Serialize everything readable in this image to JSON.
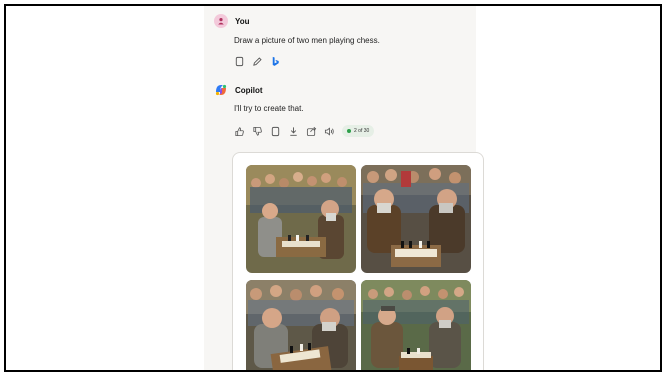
{
  "conversation": {
    "user": {
      "name": "You",
      "message": "Draw a picture of two men playing chess.",
      "actions": [
        "copy-icon",
        "edit-icon",
        "bing-icon"
      ]
    },
    "assistant": {
      "name": "Copilot",
      "message": "I'll try to create that.",
      "actions": [
        "thumbs-up-icon",
        "thumbs-down-icon",
        "copy-icon",
        "download-icon",
        "share-icon",
        "speaker-icon"
      ],
      "response_counter": "2 of 30"
    },
    "images": [
      {
        "name": "generated-image-1"
      },
      {
        "name": "generated-image-2"
      },
      {
        "name": "generated-image-3"
      },
      {
        "name": "generated-image-4"
      }
    ]
  },
  "colors": {
    "panel_bg": "#f7f6f4",
    "counter_dot": "#2e9f4a",
    "bing_blue": "#1a73e8"
  }
}
